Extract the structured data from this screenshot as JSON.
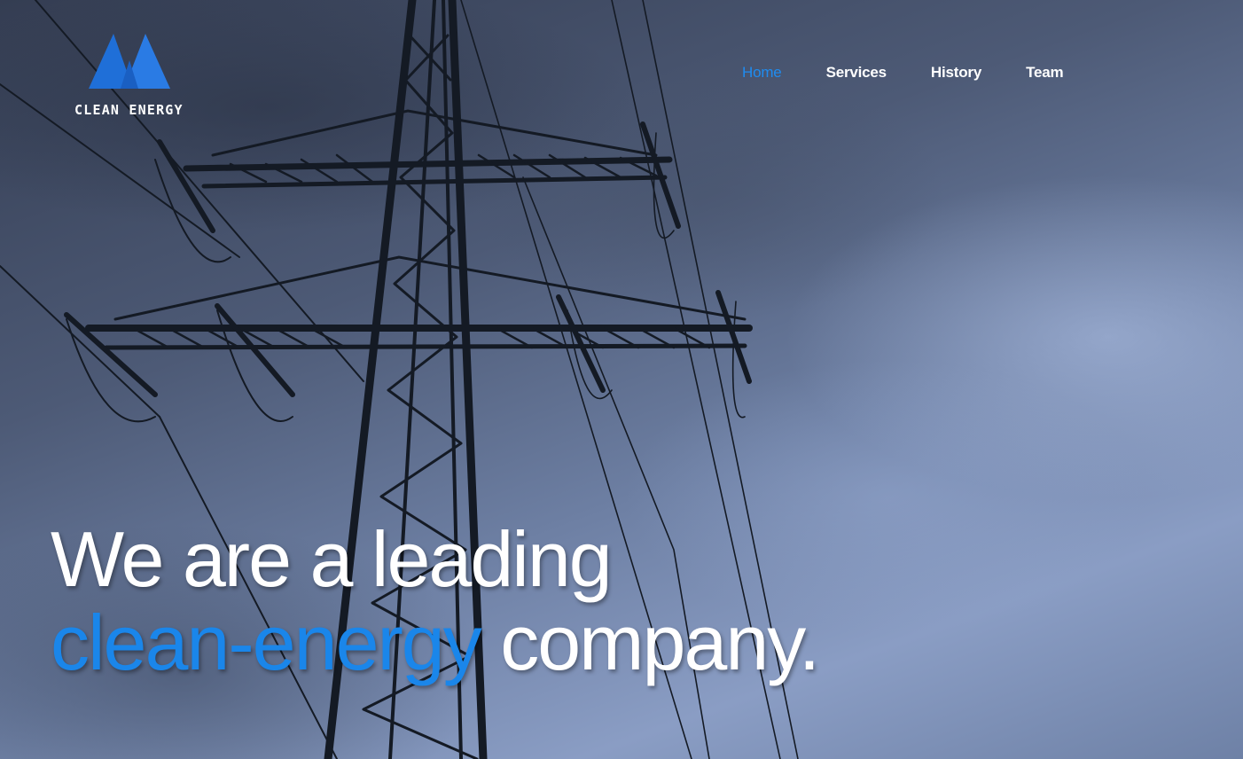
{
  "brand": {
    "name": "CLEAN ENERGY",
    "logo_icon": "twin-peaks-logo",
    "logo_color": "#1f6fd8"
  },
  "nav": {
    "items": [
      {
        "label": "Home",
        "active": true
      },
      {
        "label": "Services",
        "active": false
      },
      {
        "label": "History",
        "active": false
      },
      {
        "label": "Team",
        "active": false
      }
    ]
  },
  "hero": {
    "background": "electricity-pylon-stormy-sky",
    "headline_line1": "We are a leading",
    "headline_accent": "clean-energy",
    "headline_rest": " company."
  },
  "colors": {
    "accent": "#1a86ea",
    "text": "#ffffff"
  }
}
